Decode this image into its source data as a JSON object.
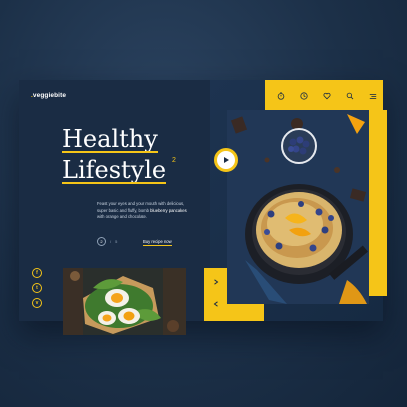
{
  "brand": {
    "name": "veggiebite",
    "dot": "."
  },
  "nav": {
    "items": [
      "timer",
      "clock",
      "heart",
      "search",
      "menu"
    ]
  },
  "hero": {
    "title_line1": "Healthy",
    "title_line2": "Lifestyle",
    "title_sup": "2"
  },
  "description": {
    "line1": "Feast your eyes and your mouth with delicious,",
    "line2_a": "super basic and fluffy, bomb ",
    "line2_highlight": "blueberry pancakes",
    "line3": "with orange and chocolate."
  },
  "slider": {
    "current": "2",
    "separator": "/",
    "total": "5"
  },
  "cta": {
    "label": "Buy recipe now"
  },
  "social": {
    "items": [
      "f",
      "t",
      "v"
    ]
  },
  "colors": {
    "accent": "#f5c518",
    "card": "#1a2c44",
    "background": "#1c3048"
  }
}
